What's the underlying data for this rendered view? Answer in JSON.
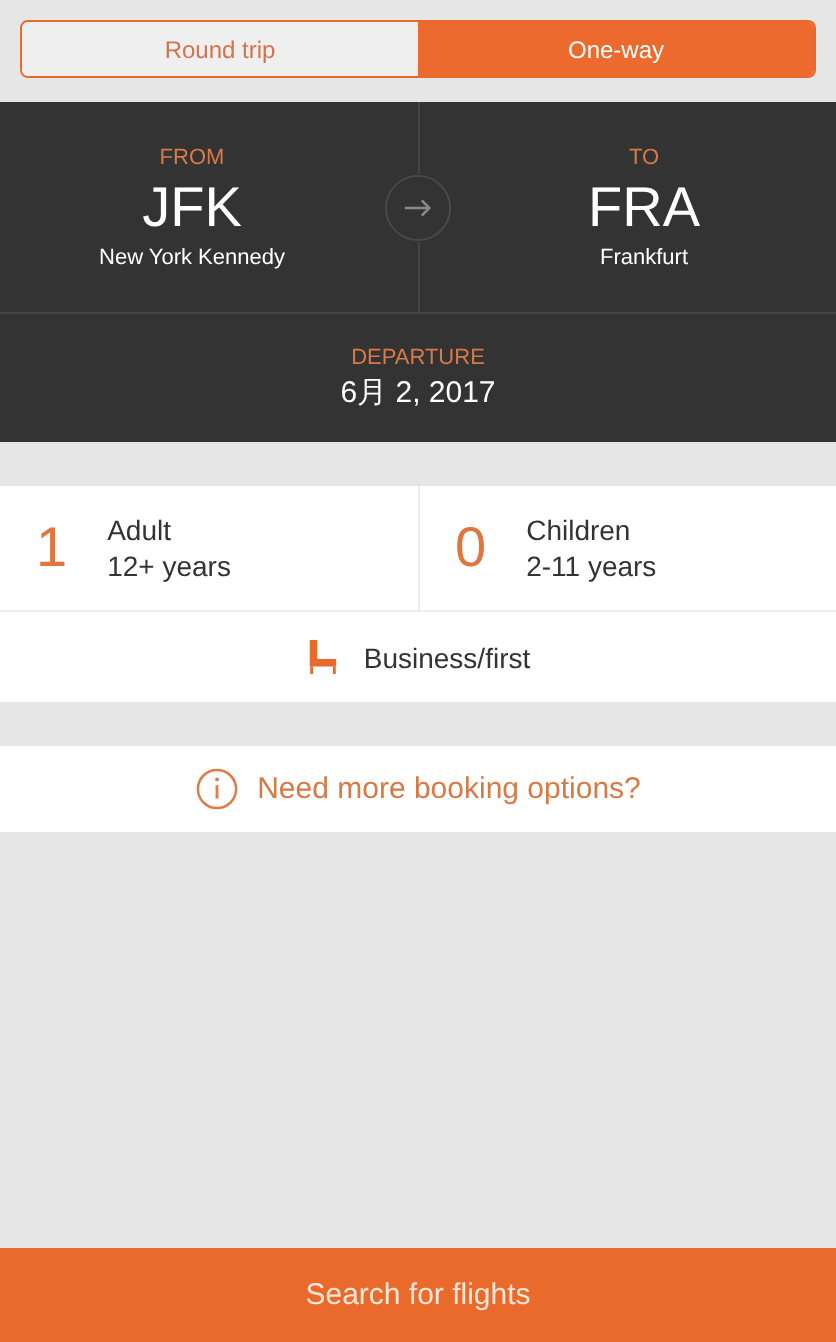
{
  "trip_tabs": [
    {
      "label": "Round trip",
      "selected": false
    },
    {
      "label": "One-way",
      "selected": true
    }
  ],
  "route": {
    "from": {
      "caption": "FROM",
      "code": "JFK",
      "city": "New York Kennedy"
    },
    "to": {
      "caption": "TO",
      "code": "FRA",
      "city": "Frankfurt"
    }
  },
  "departure": {
    "caption": "DEPARTURE",
    "date": "6月 2, 2017"
  },
  "passengers": [
    {
      "count": "1",
      "type": "Adult",
      "ages": "12+ years"
    },
    {
      "count": "0",
      "type": "Children",
      "ages": "2-11 years"
    }
  ],
  "cabin_class": "Business/first",
  "more_options": "Need more booking options?",
  "search_button": "Search for flights"
}
